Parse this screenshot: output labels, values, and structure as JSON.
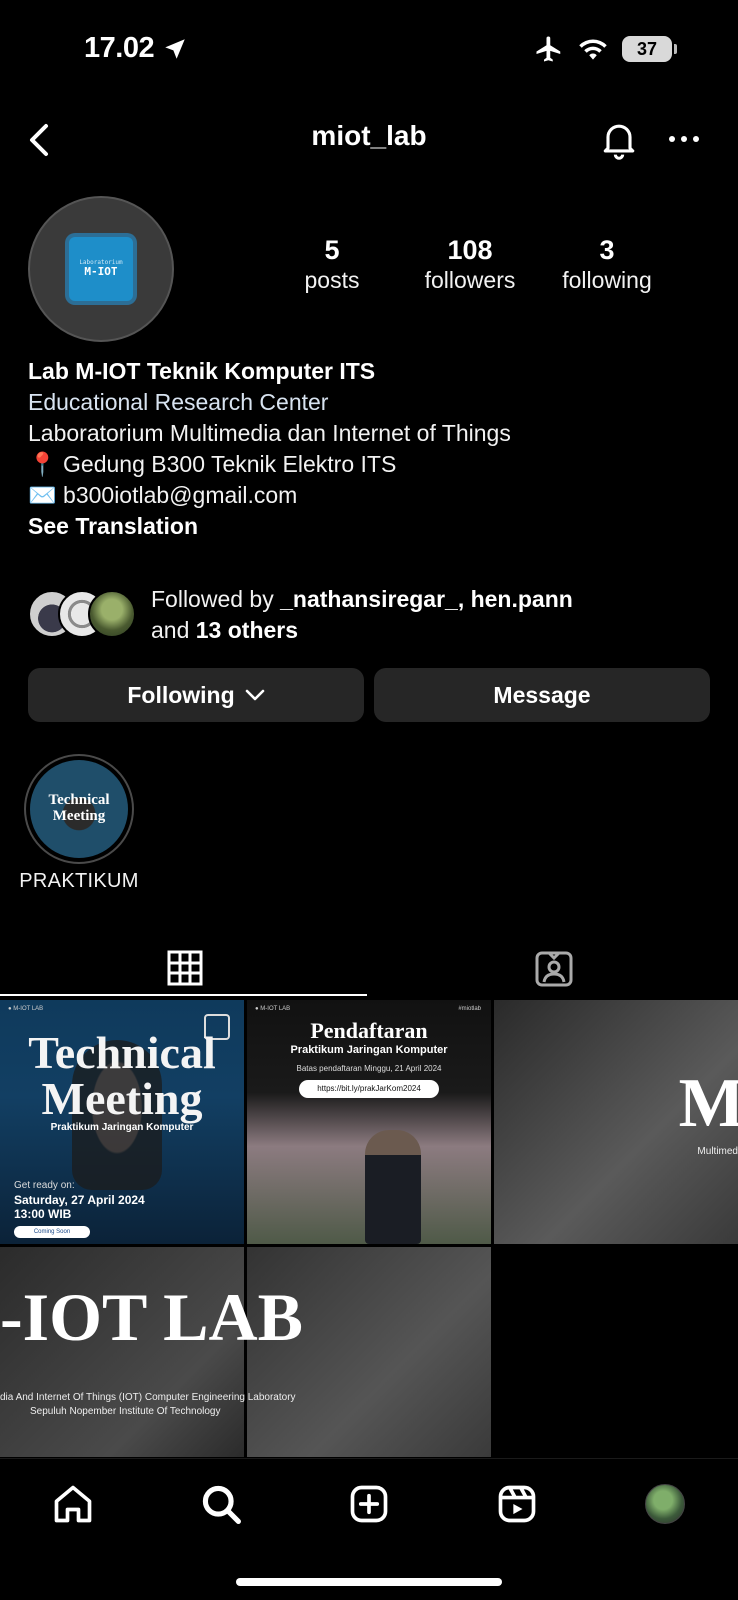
{
  "status_bar": {
    "time": "17.02",
    "battery": "37"
  },
  "header": {
    "username": "miot_lab"
  },
  "profile": {
    "avatar_text": "M-IOT",
    "avatar_subtext": "Laboratorium",
    "stats": [
      {
        "value": "5",
        "label": "posts"
      },
      {
        "value": "108",
        "label": "followers"
      },
      {
        "value": "3",
        "label": "following"
      }
    ],
    "bio": {
      "name": "Lab M-IOT Teknik Komputer ITS",
      "category": "Educational Research Center",
      "line1": "Laboratorium Multimedia dan Internet of Things",
      "location": "📍 Gedung B300 Teknik Elektro ITS",
      "email": "✉️ b300iotlab@gmail.com",
      "see_translation": "See Translation"
    },
    "followed_by": {
      "prefix": "Followed by ",
      "names": "_nathansiregar_, hen.pann",
      "and": "and ",
      "others": "13 others"
    },
    "buttons": {
      "following": "Following",
      "message": "Message"
    }
  },
  "highlights": [
    {
      "label": "PRAKTIKUM",
      "cover_text": "Technical Meeting"
    }
  ],
  "posts": {
    "p1": {
      "title1": "Technical",
      "title2": "Meeting",
      "subtitle": "Praktikum Jaringan Komputer",
      "ready": "Get ready on:",
      "date": "Saturday, 27 April 2024",
      "time": "13:00 WIB",
      "pill": "Coming Soon"
    },
    "p2": {
      "title": "Pendaftaran",
      "subtitle": "Praktikum Jaringan Komputer",
      "deadline": "Batas pendaftaran Minggu, 21 April 2024",
      "link": "https://bit.ly/prakJarKom2024",
      "tag": "#miotlab"
    },
    "p3": {
      "big": "M-",
      "small": "Multimed"
    },
    "p45": {
      "big": "-IOT LAB",
      "line1": "dia And  Internet Of Things (IOT) Computer Engineering Laboratory",
      "line2": "Sepuluh Nopember Institute Of Technology"
    }
  },
  "icons": {
    "back": "chevron-left-icon",
    "bell": "bell-icon",
    "more": "more-horizontal-icon",
    "grid": "grid-icon",
    "tagged": "tagged-user-icon",
    "home": "home-icon",
    "search": "search-icon",
    "create": "plus-square-icon",
    "reels": "reels-icon"
  }
}
